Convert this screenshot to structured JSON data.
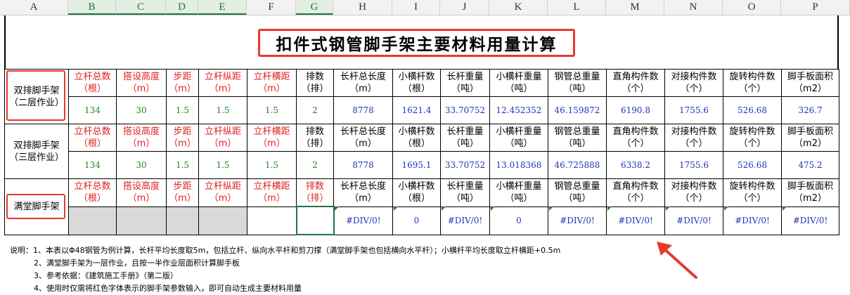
{
  "columns": [
    "A",
    "B",
    "C",
    "D",
    "E",
    "F",
    "G",
    "H",
    "I",
    "J",
    "K",
    "L",
    "M",
    "N",
    "O",
    "P"
  ],
  "title": "扣件式钢管脚手架主要材料用量计算",
  "headers": [
    "立杆总数（根）",
    "搭设高度（m）",
    "步距（m）",
    "立杆纵距（m）",
    "立杆横距（m）",
    "排数（排）",
    "长杆总长度（m）",
    "小横杆数（根）",
    "长杆重量（吨）",
    "小横杆重量（吨）",
    "钢管总重量（吨）",
    "直角构件数（个）",
    "对接构件数（个）",
    "旋转构件数（个）",
    "脚手板面积（m2）"
  ],
  "sections": [
    {
      "label": "双排脚手架（二层作业）",
      "values": [
        "134",
        "30",
        "1.5",
        "1.5",
        "1.5",
        "2",
        "8778",
        "1621.4",
        "33.70752",
        "12.452352",
        "46.159872",
        "6190.8",
        "1755.6",
        "526.68",
        "326.7"
      ]
    },
    {
      "label": "双排脚手架（三层作业）",
      "values": [
        "134",
        "30",
        "1.5",
        "1.5",
        "1.5",
        "2",
        "8778",
        "1695.1",
        "33.70752",
        "13.018368",
        "46.725888",
        "6338.2",
        "1755.6",
        "526.68",
        "475.2"
      ]
    },
    {
      "label": "满堂脚手架",
      "values": [
        "",
        "",
        "",
        "",
        "",
        "",
        "#DIV/0!",
        "0",
        "#DIV/0!",
        "0",
        "#DIV/0!",
        "#DIV/0!",
        "#DIV/0!",
        "#DIV/0!",
        "#DIV/0!"
      ]
    }
  ],
  "notes": [
    "说明：1、本表以Φ48钢管为例计算，长杆平均长度取5m，包括立杆、纵向水平杆和剪刀撑（满堂脚手架也包括横向水平杆）；小横杆平均长度取立杆横距+0.5m",
    "2、满堂脚手架为一层作业，且按一半作业层面积计算脚手板",
    "3、参考依据：《建筑施工手册》（第二版）",
    "4、使用时仅需将红色字体表示的脚手架参数输入，即可自动生成主要材料用量"
  ],
  "colors": {
    "input_red": "#e02020",
    "input_green": "#1f8a1f",
    "output_blue": "#2233bb",
    "highlight": "#e8392b",
    "excel_green": "#217346"
  }
}
